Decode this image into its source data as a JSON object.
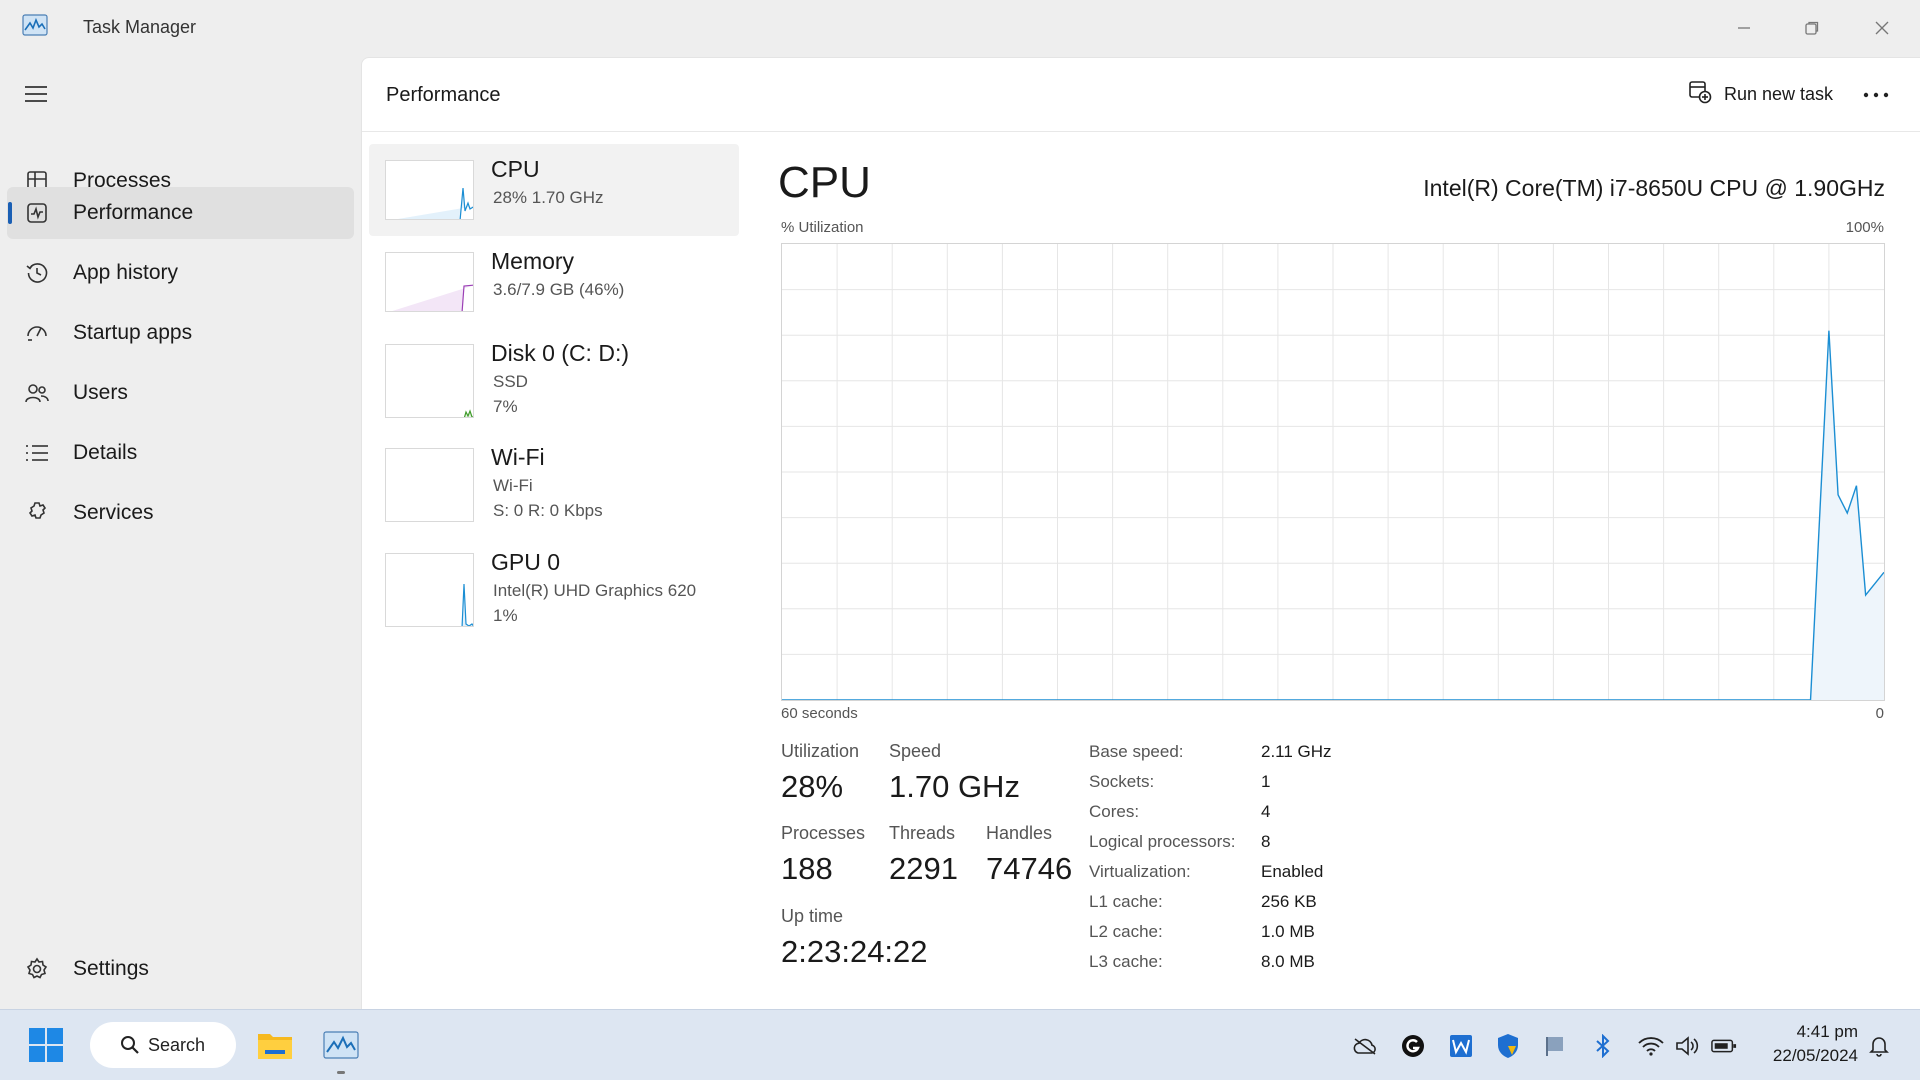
{
  "window": {
    "title": "Task Manager"
  },
  "sidebar": {
    "items": [
      {
        "label": "Processes",
        "icon": "processes-icon"
      },
      {
        "label": "Performance",
        "icon": "performance-icon",
        "active": true
      },
      {
        "label": "App history",
        "icon": "history-icon"
      },
      {
        "label": "Startup apps",
        "icon": "startup-icon"
      },
      {
        "label": "Users",
        "icon": "users-icon"
      },
      {
        "label": "Details",
        "icon": "details-icon"
      },
      {
        "label": "Services",
        "icon": "services-icon"
      }
    ],
    "settings_label": "Settings"
  },
  "header": {
    "title": "Performance",
    "run_new_task": "Run new task"
  },
  "devices": [
    {
      "name": "CPU",
      "line1": "28%  1.70 GHz",
      "line2": "",
      "selected": true,
      "color": "#1b8ed3"
    },
    {
      "name": "Memory",
      "line1": "3.6/7.9 GB (46%)",
      "line2": "",
      "color": "#9b3fb5"
    },
    {
      "name": "Disk 0 (C: D:)",
      "line1": "SSD",
      "line2": "7%",
      "color": "#3f9b2a"
    },
    {
      "name": "Wi-Fi",
      "line1": "Wi-Fi",
      "line2": "S: 0  R: 0 Kbps",
      "color": "#b06c1b"
    },
    {
      "name": "GPU 0",
      "line1": "Intel(R) UHD Graphics 620",
      "line2": "1%",
      "color": "#1b8ed3"
    }
  ],
  "detail": {
    "title": "CPU",
    "model": "Intel(R) Core(TM) i7-8650U CPU @ 1.90GHz",
    "y_axis_label": "% Utilization",
    "y_max_label": "100%",
    "x_left_label": "60 seconds",
    "x_right_label": "0",
    "stats": {
      "utilization_label": "Utilization",
      "utilization": "28%",
      "speed_label": "Speed",
      "speed": "1.70 GHz",
      "processes_label": "Processes",
      "processes": "188",
      "threads_label": "Threads",
      "threads": "2291",
      "handles_label": "Handles",
      "handles": "74746",
      "uptime_label": "Up time",
      "uptime": "2:23:24:22"
    },
    "specs": [
      {
        "label": "Base speed:",
        "value": "2.11 GHz"
      },
      {
        "label": "Sockets:",
        "value": "1"
      },
      {
        "label": "Cores:",
        "value": "4"
      },
      {
        "label": "Logical processors:",
        "value": "8"
      },
      {
        "label": "Virtualization:",
        "value": "Enabled"
      },
      {
        "label": "L1 cache:",
        "value": "256 KB"
      },
      {
        "label": "L2 cache:",
        "value": "1.0 MB"
      },
      {
        "label": "L3 cache:",
        "value": "8.0 MB"
      }
    ]
  },
  "chart_data": {
    "type": "area",
    "x": [
      60,
      4,
      3,
      2.5,
      2,
      1.5,
      1,
      0
    ],
    "series": [
      {
        "values": [
          0,
          0,
          81,
          45,
          41,
          47,
          23,
          28
        ]
      }
    ],
    "xlim": [
      60,
      0
    ],
    "ylim": [
      0,
      100
    ],
    "xlabel": "",
    "ylabel": "% Utilization",
    "grid": true,
    "color": "#1b8ed3"
  },
  "taskbar": {
    "search_label": "Search",
    "time": "4:41 pm",
    "date": "22/05/2024",
    "tray_icons": [
      "onedrive-icon",
      "grammarly-icon",
      "word-icon",
      "defender-icon",
      "flag-icon",
      "bluetooth-icon",
      "wifi-icon",
      "volume-icon",
      "battery-icon",
      "notification-icon"
    ]
  }
}
